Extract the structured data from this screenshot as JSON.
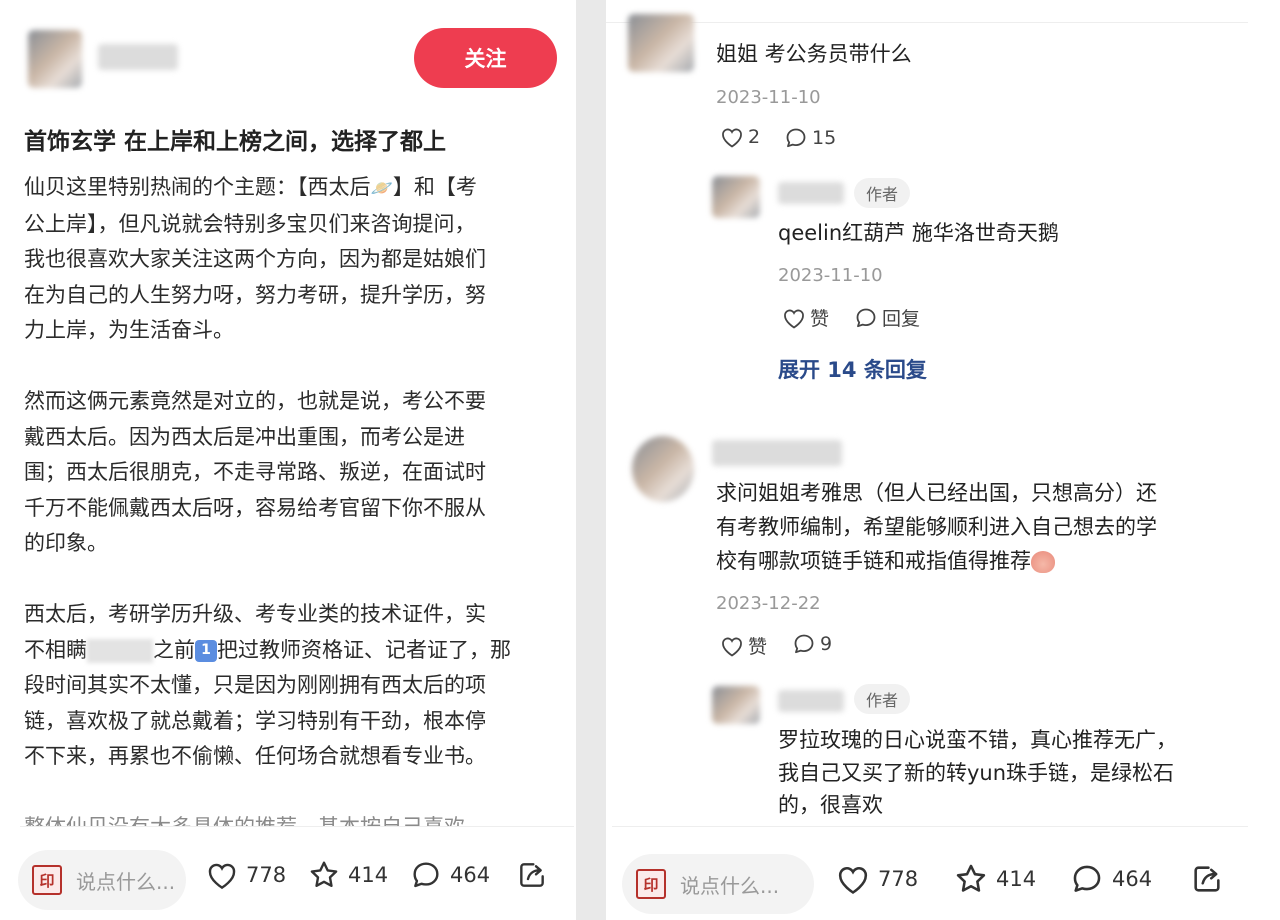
{
  "left": {
    "follow_label": "关注",
    "title": "首饰玄学 在上岸和上榜之间，选择了都上",
    "para1": [
      "仙贝这里特别热闹的个主题：【西太后",
      "】和【考",
      "公上岸】，但凡说就会特别多宝贝们来咨询提问，",
      "我也很喜欢大家关注这两个方向，因为都是姑娘们",
      "在为自己的人生努力呀，努力考研，提升学历，努",
      "力上岸，为生活奋斗。"
    ],
    "para2": [
      "然而这俩元素竟然是对立的，也就是说，考公不要",
      "戴西太后。因为西太后是冲出重围，而考公是进",
      "围；西太后很朋克，不走寻常路、叛逆，在面试时",
      "千万不能佩戴西太后呀，容易给考官留下你不服从",
      "的印象。"
    ],
    "para3": [
      "西太后，考研学历升级、考专业类的技术证件，实",
      "不相瞒",
      "之前",
      "1",
      "把过教师资格证、记者证了，那",
      "段时间其实不太懂，只是因为刚刚拥有西太后的项",
      "链，喜欢极了就总戴着；学习特别有干劲，根本停",
      "不下来，再累也不偷懒、任何场合就想看专业书。"
    ],
    "para4_partial": "整体仙贝没有太多具体的推荐，基本按自己喜欢",
    "bottom": {
      "placeholder": "说点什么...",
      "likes": "778",
      "stars": "414",
      "comments": "464"
    }
  },
  "right": {
    "comment1": {
      "text": "姐姐 考公务员带什么",
      "date": "2023-11-10",
      "likes": "2",
      "replies": "15"
    },
    "reply1": {
      "badge": "作者",
      "text": "qeelin红葫芦 施华洛世奇天鹅",
      "date": "2023-11-10",
      "like_label": "赞",
      "reply_label": "回复"
    },
    "expand": "展开 14 条回复",
    "comment2": {
      "lines": [
        "求问姐姐考雅思（但人已经出国，只想高分）还",
        "有考教师编制，希望能够顺利进入自己想去的学",
        "校有哪款项链手链和戒指值得推荐"
      ],
      "date": "2023-12-22",
      "like_label": "赞",
      "replies": "9"
    },
    "reply2": {
      "badge": "作者",
      "lines": [
        "罗拉玫瑰的日心说蛮不错，真心推荐无广，",
        "我自己又买了新的转yun珠手链，是绿松石",
        "的，很喜欢"
      ]
    },
    "bottom": {
      "placeholder": "说点什么...",
      "likes": "778",
      "stars": "414",
      "comments": "464"
    }
  },
  "icons": [
    "heart-icon",
    "star-icon",
    "comment-bubble-icon",
    "share-icon",
    "stamp-icon"
  ],
  "colors": {
    "follow_button": "#ee3d50",
    "expand_link": "#2a4a8a",
    "muted": "#999999"
  }
}
